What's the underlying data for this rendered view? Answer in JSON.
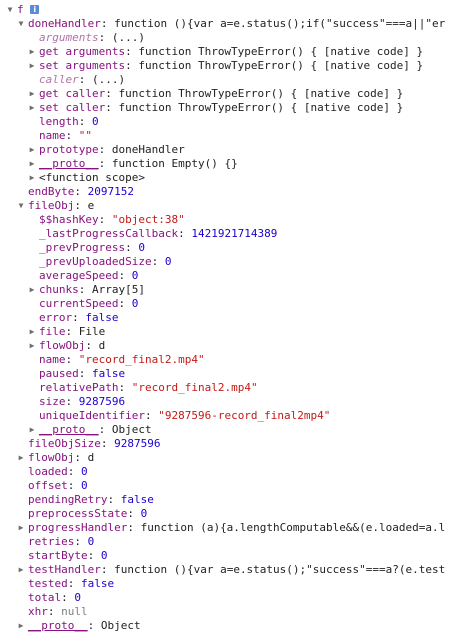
{
  "rows": [
    {
      "key": "f",
      "value": "",
      "type": "plain",
      "tri": "open",
      "depth": 0,
      "info": true
    },
    {
      "key": "doneHandler",
      "value": "function (){var a=e.status();if(\"success\"===a||\"er",
      "type": "plain",
      "tri": "open",
      "depth": 1
    },
    {
      "key": "arguments",
      "value": "(...)",
      "type": "plain",
      "tri": "none",
      "depth": 2,
      "dim": true
    },
    {
      "key": "get arguments",
      "value": "function ThrowTypeError() { [native code] }",
      "type": "plain",
      "tri": "closed",
      "depth": 2
    },
    {
      "key": "set arguments",
      "value": "function ThrowTypeError() { [native code] }",
      "type": "plain",
      "tri": "closed",
      "depth": 2
    },
    {
      "key": "caller",
      "value": "(...)",
      "type": "plain",
      "tri": "none",
      "depth": 2,
      "dim": true
    },
    {
      "key": "get caller",
      "value": "function ThrowTypeError() { [native code] }",
      "type": "plain",
      "tri": "closed",
      "depth": 2
    },
    {
      "key": "set caller",
      "value": "function ThrowTypeError() { [native code] }",
      "type": "plain",
      "tri": "closed",
      "depth": 2
    },
    {
      "key": "length",
      "value": "0",
      "type": "num",
      "tri": "none",
      "depth": 2
    },
    {
      "key": "name",
      "value": "\"\"",
      "type": "str",
      "tri": "none",
      "depth": 2
    },
    {
      "key": "prototype",
      "value": "doneHandler",
      "type": "plain",
      "tri": "closed",
      "depth": 2
    },
    {
      "key": "__proto__",
      "value": "function Empty() {}",
      "type": "plain",
      "tri": "closed",
      "depth": 2
    },
    {
      "key": "",
      "value": "<function scope>",
      "type": "plain",
      "tri": "closed",
      "depth": 2
    },
    {
      "key": "endByte",
      "value": "2097152",
      "type": "num",
      "tri": "none",
      "depth": 1
    },
    {
      "key": "fileObj",
      "value": "e",
      "type": "plain",
      "tri": "open",
      "depth": 1
    },
    {
      "key": "$$hashKey",
      "value": "\"object:38\"",
      "type": "str",
      "tri": "none",
      "depth": 2
    },
    {
      "key": "_lastProgressCallback",
      "value": "1421921714389",
      "type": "num",
      "tri": "none",
      "depth": 2
    },
    {
      "key": "_prevProgress",
      "value": "0",
      "type": "num",
      "tri": "none",
      "depth": 2
    },
    {
      "key": "_prevUploadedSize",
      "value": "0",
      "type": "num",
      "tri": "none",
      "depth": 2
    },
    {
      "key": "averageSpeed",
      "value": "0",
      "type": "num",
      "tri": "none",
      "depth": 2
    },
    {
      "key": "chunks",
      "value": "Array[5]",
      "type": "plain",
      "tri": "closed",
      "depth": 2
    },
    {
      "key": "currentSpeed",
      "value": "0",
      "type": "num",
      "tri": "none",
      "depth": 2
    },
    {
      "key": "error",
      "value": "false",
      "type": "kw",
      "tri": "none",
      "depth": 2
    },
    {
      "key": "file",
      "value": "File",
      "type": "plain",
      "tri": "closed",
      "depth": 2
    },
    {
      "key": "flowObj",
      "value": "d",
      "type": "plain",
      "tri": "closed",
      "depth": 2
    },
    {
      "key": "name",
      "value": "\"record_final2.mp4\"",
      "type": "str",
      "tri": "none",
      "depth": 2
    },
    {
      "key": "paused",
      "value": "false",
      "type": "kw",
      "tri": "none",
      "depth": 2
    },
    {
      "key": "relativePath",
      "value": "\"record_final2.mp4\"",
      "type": "str",
      "tri": "none",
      "depth": 2
    },
    {
      "key": "size",
      "value": "9287596",
      "type": "num",
      "tri": "none",
      "depth": 2
    },
    {
      "key": "uniqueIdentifier",
      "value": "\"9287596-record_final2mp4\"",
      "type": "str",
      "tri": "none",
      "depth": 2
    },
    {
      "key": "__proto__",
      "value": "Object",
      "type": "plain",
      "tri": "closed",
      "depth": 2
    },
    {
      "key": "fileObjSize",
      "value": "9287596",
      "type": "num",
      "tri": "none",
      "depth": 1
    },
    {
      "key": "flowObj",
      "value": "d",
      "type": "plain",
      "tri": "closed",
      "depth": 1
    },
    {
      "key": "loaded",
      "value": "0",
      "type": "num",
      "tri": "none",
      "depth": 1
    },
    {
      "key": "offset",
      "value": "0",
      "type": "num",
      "tri": "none",
      "depth": 1
    },
    {
      "key": "pendingRetry",
      "value": "false",
      "type": "kw",
      "tri": "none",
      "depth": 1
    },
    {
      "key": "preprocessState",
      "value": "0",
      "type": "num",
      "tri": "none",
      "depth": 1
    },
    {
      "key": "progressHandler",
      "value": "function (a){a.lengthComputable&&(e.loaded=a.l",
      "type": "plain",
      "tri": "closed",
      "depth": 1
    },
    {
      "key": "retries",
      "value": "0",
      "type": "num",
      "tri": "none",
      "depth": 1
    },
    {
      "key": "startByte",
      "value": "0",
      "type": "num",
      "tri": "none",
      "depth": 1
    },
    {
      "key": "testHandler",
      "value": "function (){var a=e.status();\"success\"===a?(e.test",
      "type": "plain",
      "tri": "closed",
      "depth": 1
    },
    {
      "key": "tested",
      "value": "false",
      "type": "kw",
      "tri": "none",
      "depth": 1
    },
    {
      "key": "total",
      "value": "0",
      "type": "num",
      "tri": "none",
      "depth": 1
    },
    {
      "key": "xhr",
      "value": "null",
      "type": "gray",
      "tri": "none",
      "depth": 1
    },
    {
      "key": "__proto__",
      "value": "Object",
      "type": "plain",
      "tri": "closed",
      "depth": 1
    }
  ],
  "info_icon_label": "i",
  "triangles": {
    "open": "▼",
    "closed": "▶"
  }
}
